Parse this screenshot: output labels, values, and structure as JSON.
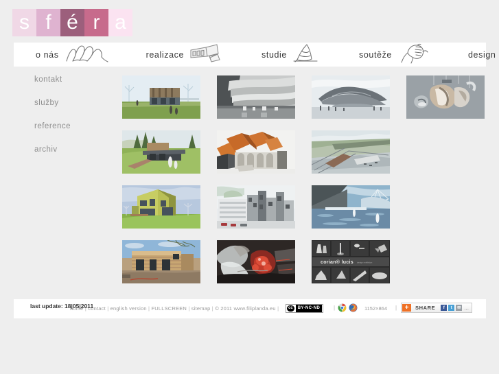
{
  "site": {
    "logo_letters": [
      {
        "char": "s",
        "bg": "#f0d8e6"
      },
      {
        "char": "f",
        "bg": "#dfb3d0"
      },
      {
        "char": "é",
        "bg": "#9c5f7c"
      },
      {
        "char": "r",
        "bg": "#c76b8c"
      },
      {
        "char": "a",
        "bg": "#fbe3f1"
      }
    ]
  },
  "nav": {
    "items": [
      {
        "label": "o nás",
        "icon": "people-icon"
      },
      {
        "label": "realizace",
        "icon": "building-icon"
      },
      {
        "label": "studie",
        "icon": "cone-sketch-icon"
      },
      {
        "label": "soutěže",
        "icon": "fist-icon"
      },
      {
        "label": "design",
        "icon": "sphere-icon"
      }
    ]
  },
  "sidebar": {
    "items": [
      {
        "label": "kontakt"
      },
      {
        "label": "služby"
      },
      {
        "label": "reference"
      },
      {
        "label": "archiv"
      }
    ]
  },
  "gallery": {
    "thumbs": [
      {
        "name": "thumb-house-green-lawn",
        "kind": "house-green"
      },
      {
        "name": "thumb-parametric-interior",
        "kind": "parametric-bw"
      },
      {
        "name": "thumb-pavilion-structure",
        "kind": "pavilion"
      },
      {
        "name": "thumb-design-lamp-object",
        "kind": "design-object"
      },
      {
        "name": "thumb-villa-hillside",
        "kind": "villa-hill"
      },
      {
        "name": "thumb-orange-roof-building",
        "kind": "orange-roofs"
      },
      {
        "name": "thumb-site-plan-aerial",
        "kind": "aerial-plan"
      },
      {
        "name": "thumb-placeholder-empty-1",
        "kind": "empty"
      },
      {
        "name": "thumb-yellow-gable-house",
        "kind": "yellow-house"
      },
      {
        "name": "thumb-office-complex",
        "kind": "office-complex"
      },
      {
        "name": "thumb-waterfront-canopy",
        "kind": "waterfront"
      },
      {
        "name": "thumb-placeholder-empty-2",
        "kind": "empty"
      },
      {
        "name": "thumb-timber-house-photo",
        "kind": "timber-photo"
      },
      {
        "name": "thumb-red-abstract-render",
        "kind": "red-abstract"
      },
      {
        "name": "thumb-corian-lucis-board",
        "kind": "corian-lucis"
      },
      {
        "name": "thumb-placeholder-empty-3",
        "kind": "empty"
      }
    ],
    "corian_caption": "corian® lucis"
  },
  "footer": {
    "last_update": "last update: 18|05|2011",
    "links": [
      {
        "label": "home"
      },
      {
        "label": "contact"
      },
      {
        "label": "english version"
      },
      {
        "label": "FULLSCREEN"
      },
      {
        "label": "sitemap"
      }
    ],
    "separator": "|",
    "copyright": "© 2011  www.filiplanda.eu",
    "license": {
      "mark": "cc",
      "text": "BY-NC-ND"
    },
    "browsers": [
      "chrome-icon",
      "firefox-icon"
    ],
    "resolution": "1152×864",
    "share": {
      "plus": "+",
      "label": "SHARE",
      "icons": [
        "facebook-icon",
        "twitter-icon",
        "email-icon"
      ],
      "more": "..."
    }
  },
  "colors": {
    "page_bg": "#eeeeee",
    "panel_bg": "#ffffff",
    "text_muted": "#8e8e8e",
    "accent_pink": "#c76b8c"
  }
}
